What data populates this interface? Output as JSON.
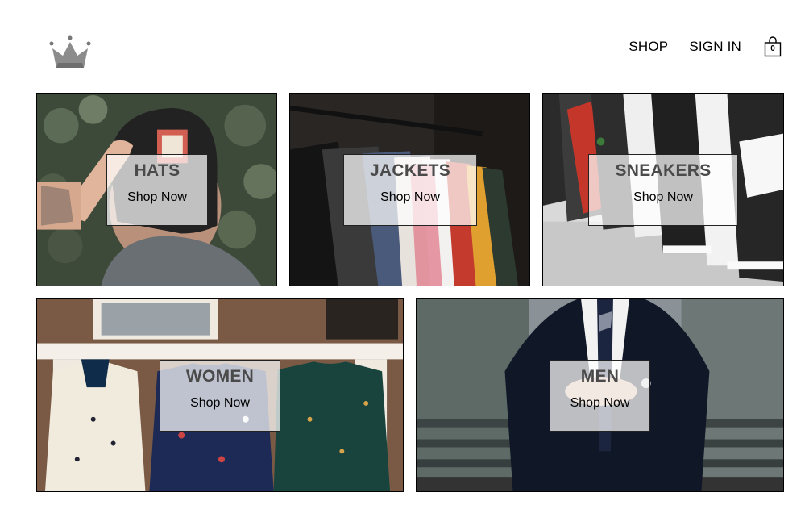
{
  "header": {
    "logo_icon": "crown-icon",
    "nav": [
      {
        "label": "SHOP"
      },
      {
        "label": "SIGN IN"
      }
    ],
    "cart": {
      "icon": "shopping-bag-icon",
      "count": "0"
    }
  },
  "categories": [
    {
      "title": "HATS",
      "cta": "Shop Now"
    },
    {
      "title": "JACKETS",
      "cta": "Shop Now"
    },
    {
      "title": "SNEAKERS",
      "cta": "Shop Now"
    },
    {
      "title": "WOMEN",
      "cta": "Shop Now"
    },
    {
      "title": "MEN",
      "cta": "Shop Now"
    }
  ],
  "colors": {
    "overlay": "#ffffff",
    "title_text": "#4a4a4a",
    "border": "#000000"
  }
}
